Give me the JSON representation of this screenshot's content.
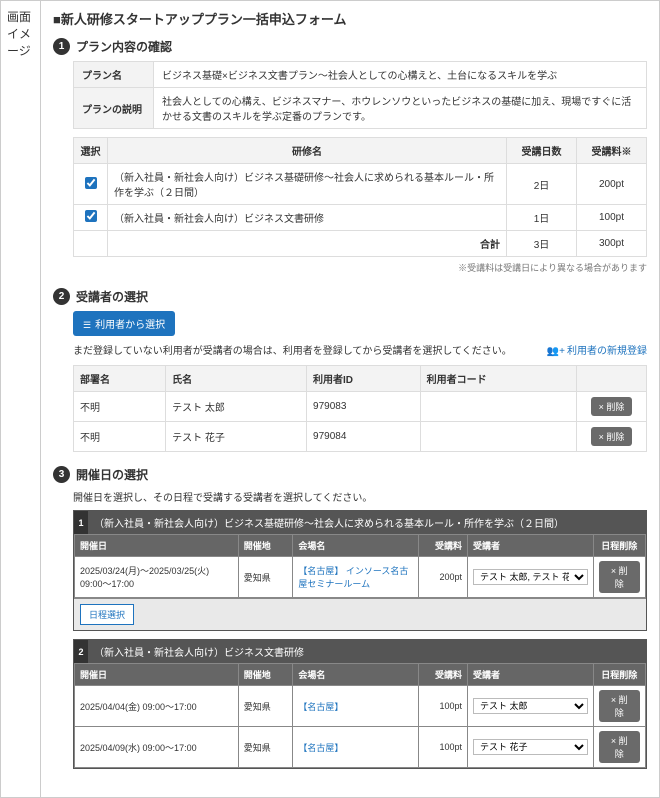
{
  "sidebar_label": "画面イメージ",
  "page_title": "■新人研修スタートアッププラン一括申込フォーム",
  "sec1": {
    "title": "プラン内容の確認",
    "plan_name_label": "プラン名",
    "plan_name": "ビジネス基礎×ビジネス文書プラン～社会人としての心構えと、土台になるスキルを学ぶ",
    "plan_desc_label": "プランの説明",
    "plan_desc": "社会人としての心構え、ビジネスマナー、ホウレンソウといったビジネスの基礎に加え、現場ですぐに活かせる文書のスキルを学ぶ定番のプランです。",
    "col_select": "選択",
    "col_name": "研修名",
    "col_days": "受講日数",
    "col_fee": "受講料※",
    "courses": [
      {
        "name": "（新入社員・新社会人向け）ビジネス基礎研修～社会人に求められる基本ルール・所作を学ぶ（２日間）",
        "days": "2日",
        "fee": "200pt"
      },
      {
        "name": "（新入社員・新社会人向け）ビジネス文書研修",
        "days": "1日",
        "fee": "100pt"
      }
    ],
    "total_label": "合計",
    "total_days": "3日",
    "total_fee": "300pt",
    "note": "※受講料は受講日により異なる場合があります"
  },
  "sec2": {
    "title": "受講者の選択",
    "select_btn": "利用者から選択",
    "helper": "まだ登録していない利用者が受講者の場合は、利用者を登録してから受講者を選択してください。",
    "new_user_link": "利用者の新規登録",
    "col_dept": "部署名",
    "col_name": "氏名",
    "col_uid": "利用者ID",
    "col_ucode": "利用者コード",
    "delete_label": "× 削除",
    "attendees": [
      {
        "dept": "不明",
        "name": "テスト 太郎",
        "uid": "979083",
        "ucode": ""
      },
      {
        "dept": "不明",
        "name": "テスト 花子",
        "uid": "979084",
        "ucode": ""
      }
    ]
  },
  "sec3": {
    "title": "開催日の選択",
    "helper": "開催日を選択し、その日程で受講する受講者を選択してください。",
    "col_date": "開催日",
    "col_loc": "開催地",
    "col_venue": "会場名",
    "col_fee": "受講料",
    "col_att": "受講者",
    "col_del": "日程削除",
    "delete_label": "× 削除",
    "date_select_btn": "日程選択",
    "blocks": [
      {
        "idx": "1",
        "title": "（新入社員・新社会人向け）ビジネス基礎研修～社会人に求められる基本ルール・所作を学ぶ（２日間）",
        "rows": [
          {
            "date": "2025/03/24(月)～2025/03/25(火) 09:00～17:00",
            "loc": "愛知県",
            "venue": "【名古屋】 インソース名古屋セミナールーム",
            "fee": "200pt",
            "att": "テスト 太郎, テスト 花子"
          }
        ],
        "show_footer": true
      },
      {
        "idx": "2",
        "title": "（新入社員・新社会人向け）ビジネス文書研修",
        "rows": [
          {
            "date": "2025/04/04(金) 09:00～17:00",
            "loc": "愛知県",
            "venue": "【名古屋】",
            "fee": "100pt",
            "att": "テスト 太郎"
          },
          {
            "date": "2025/04/09(水) 09:00～17:00",
            "loc": "愛知県",
            "venue": "【名古屋】",
            "fee": "100pt",
            "att": "テスト 花子"
          }
        ],
        "show_footer": false
      }
    ]
  }
}
